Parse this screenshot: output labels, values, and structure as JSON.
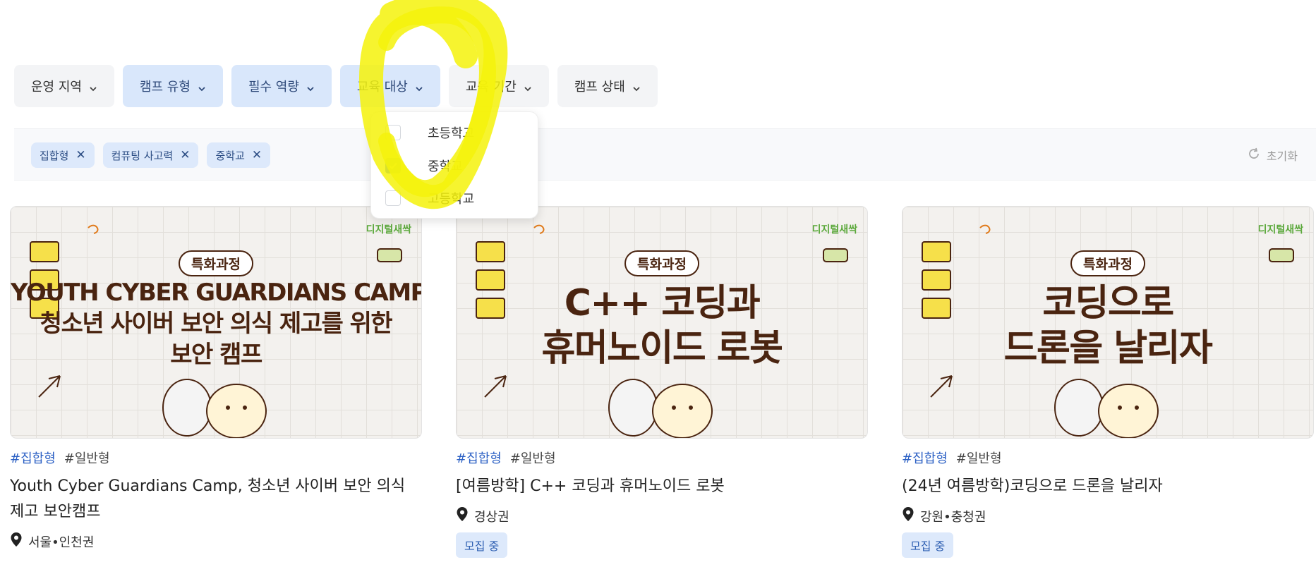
{
  "filters": [
    {
      "label": "운영 지역",
      "active": false
    },
    {
      "label": "캠프 유형",
      "active": true
    },
    {
      "label": "필수 역량",
      "active": true
    },
    {
      "label": "교육 대상",
      "active": true
    },
    {
      "label": "교육 기간",
      "active": false
    },
    {
      "label": "캠프 상태",
      "active": false
    }
  ],
  "selected_chips": [
    "집합형",
    "컴퓨팅 사고력",
    "중학교"
  ],
  "reset_label": "초기화",
  "dropdown": {
    "options": [
      {
        "label": "초등학교",
        "checked": false
      },
      {
        "label": "중학교",
        "checked": true
      },
      {
        "label": "고등학교",
        "checked": false
      }
    ]
  },
  "cards": [
    {
      "thumb": {
        "brand": "디지털새싹",
        "badge": "특화과정",
        "lines": [
          "YOUTH CYBER GUARDIANS CAMP,",
          "청소년 사이버 보안 의식 제고를 위한",
          "보안 캠프"
        ]
      },
      "tags": [
        "#집합형",
        "#일반형"
      ],
      "title": "Youth Cyber Guardians Camp, 청소년 사이버 보안 의식 제고 보안캠프",
      "location": "서울•인천권",
      "status": ""
    },
    {
      "thumb": {
        "brand": "디지털새싹",
        "badge": "특화과정",
        "lines": [
          "C++ 코딩과",
          "휴머노이드 로봇"
        ]
      },
      "tags": [
        "#집합형",
        "#일반형"
      ],
      "title": "[여름방학] C++ 코딩과 휴머노이드 로봇",
      "location": "경상권",
      "status": "모집 중"
    },
    {
      "thumb": {
        "brand": "디지털새싹",
        "badge": "특화과정",
        "lines": [
          "코딩으로",
          "드론을 날리자"
        ]
      },
      "tags": [
        "#집합형",
        "#일반형"
      ],
      "title": "(24년 여름방학)코딩으로 드론을 날리자",
      "location": "강원•충청권",
      "status": "모집 중"
    }
  ],
  "colors": {
    "accent": "#2a5fc4",
    "chip_bg": "#dde9fb",
    "highlighter": "#f5f20a",
    "headline": "#4a2410"
  }
}
